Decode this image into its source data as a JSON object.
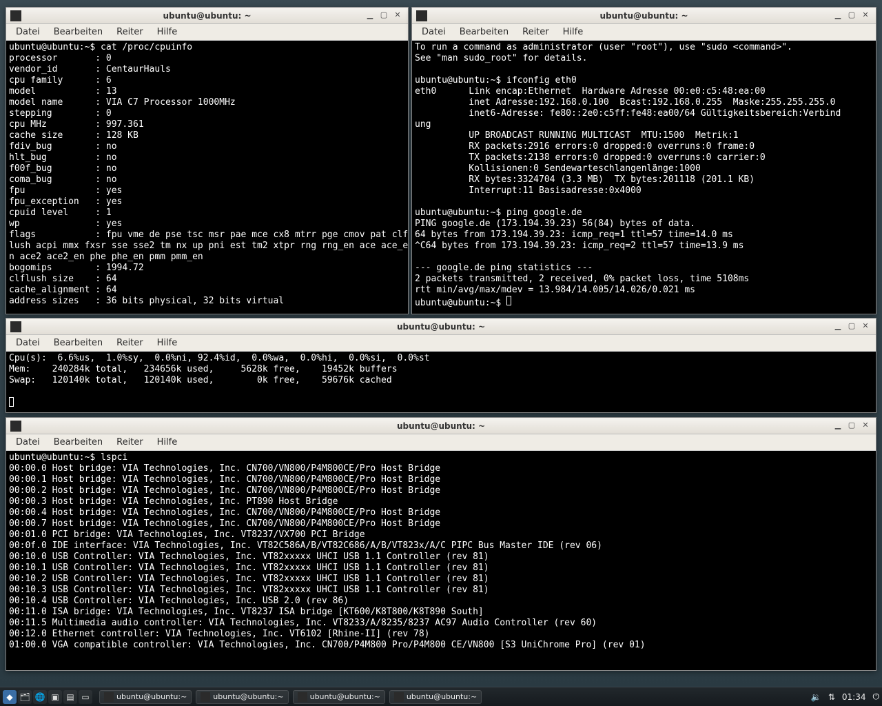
{
  "menu": {
    "file": "Datei",
    "edit": "Bearbeiten",
    "tabs": "Reiter",
    "help": "Hilfe"
  },
  "winbtns": {
    "min": "▁",
    "max": "▢",
    "close": "✕"
  },
  "win1": {
    "title": "ubuntu@ubuntu: ~",
    "body": "ubuntu@ubuntu:~$ cat /proc/cpuinfo\nprocessor       : 0\nvendor_id       : CentaurHauls\ncpu family      : 6\nmodel           : 13\nmodel name      : VIA C7 Processor 1000MHz\nstepping        : 0\ncpu MHz         : 997.361\ncache size      : 128 KB\nfdiv_bug        : no\nhlt_bug         : no\nf00f_bug        : no\ncoma_bug        : no\nfpu             : yes\nfpu_exception   : yes\ncpuid level     : 1\nwp              : yes\nflags           : fpu vme de pse tsc msr pae mce cx8 mtrr pge cmov pat clf\nlush acpi mmx fxsr sse sse2 tm nx up pni est tm2 xtpr rng rng_en ace ace_e\nn ace2 ace2_en phe phe_en pmm pmm_en\nbogomips        : 1994.72\nclflush size    : 64\ncache_alignment : 64\naddress sizes   : 36 bits physical, 32 bits virtual"
  },
  "win2": {
    "title": "ubuntu@ubuntu: ~",
    "body": "To run a command as administrator (user \"root\"), use \"sudo <command>\".\nSee \"man sudo_root\" for details.\n\nubuntu@ubuntu:~$ ifconfig eth0\neth0      Link encap:Ethernet  Hardware Adresse 00:e0:c5:48:ea:00\n          inet Adresse:192.168.0.100  Bcast:192.168.0.255  Maske:255.255.255.0\n          inet6-Adresse: fe80::2e0:c5ff:fe48:ea00/64 Gültigkeitsbereich:Verbind\nung\n          UP BROADCAST RUNNING MULTICAST  MTU:1500  Metrik:1\n          RX packets:2916 errors:0 dropped:0 overruns:0 frame:0\n          TX packets:2138 errors:0 dropped:0 overruns:0 carrier:0\n          Kollisionen:0 Sendewarteschlangenlänge:1000\n          RX bytes:3324704 (3.3 MB)  TX bytes:201118 (201.1 KB)\n          Interrupt:11 Basisadresse:0x4000\n\nubuntu@ubuntu:~$ ping google.de\nPING google.de (173.194.39.23) 56(84) bytes of data.\n64 bytes from 173.194.39.23: icmp_req=1 ttl=57 time=14.0 ms\n^C64 bytes from 173.194.39.23: icmp_req=2 ttl=57 time=13.9 ms\n\n--- google.de ping statistics ---\n2 packets transmitted, 2 received, 0% packet loss, time 5108ms\nrtt min/avg/max/mdev = 13.984/14.005/14.026/0.021 ms\nubuntu@ubuntu:~$ "
  },
  "win3": {
    "title": "ubuntu@ubuntu: ~",
    "body": "Cpu(s):  6.6%us,  1.0%sy,  0.0%ni, 92.4%id,  0.0%wa,  0.0%hi,  0.0%si,  0.0%st\nMem:    240284k total,   234656k used,     5628k free,    19452k buffers\nSwap:   120140k total,   120140k used,        0k free,    59676k cached\n"
  },
  "win4": {
    "title": "ubuntu@ubuntu: ~",
    "body": "ubuntu@ubuntu:~$ lspci\n00:00.0 Host bridge: VIA Technologies, Inc. CN700/VN800/P4M800CE/Pro Host Bridge\n00:00.1 Host bridge: VIA Technologies, Inc. CN700/VN800/P4M800CE/Pro Host Bridge\n00:00.2 Host bridge: VIA Technologies, Inc. CN700/VN800/P4M800CE/Pro Host Bridge\n00:00.3 Host bridge: VIA Technologies, Inc. PT890 Host Bridge\n00:00.4 Host bridge: VIA Technologies, Inc. CN700/VN800/P4M800CE/Pro Host Bridge\n00:00.7 Host bridge: VIA Technologies, Inc. CN700/VN800/P4M800CE/Pro Host Bridge\n00:01.0 PCI bridge: VIA Technologies, Inc. VT8237/VX700 PCI Bridge\n00:0f.0 IDE interface: VIA Technologies, Inc. VT82C586A/B/VT82C686/A/B/VT823x/A/C PIPC Bus Master IDE (rev 06)\n00:10.0 USB Controller: VIA Technologies, Inc. VT82xxxxx UHCI USB 1.1 Controller (rev 81)\n00:10.1 USB Controller: VIA Technologies, Inc. VT82xxxxx UHCI USB 1.1 Controller (rev 81)\n00:10.2 USB Controller: VIA Technologies, Inc. VT82xxxxx UHCI USB 1.1 Controller (rev 81)\n00:10.3 USB Controller: VIA Technologies, Inc. VT82xxxxx UHCI USB 1.1 Controller (rev 81)\n00:10.4 USB Controller: VIA Technologies, Inc. USB 2.0 (rev 86)\n00:11.0 ISA bridge: VIA Technologies, Inc. VT8237 ISA bridge [KT600/K8T800/K8T890 South]\n00:11.5 Multimedia audio controller: VIA Technologies, Inc. VT8233/A/8235/8237 AC97 Audio Controller (rev 60)\n00:12.0 Ethernet controller: VIA Technologies, Inc. VT6102 [Rhine-II] (rev 78)\n01:00.0 VGA compatible controller: VIA Technologies, Inc. CN700/P4M800 Pro/P4M800 CE/VN800 [S3 UniChrome Pro] (rev 01)"
  },
  "panel": {
    "tasks": [
      "ubuntu@ubuntu:~",
      "ubuntu@ubuntu:~",
      "ubuntu@ubuntu:~",
      "ubuntu@ubuntu:~"
    ],
    "clock": "01:34"
  }
}
